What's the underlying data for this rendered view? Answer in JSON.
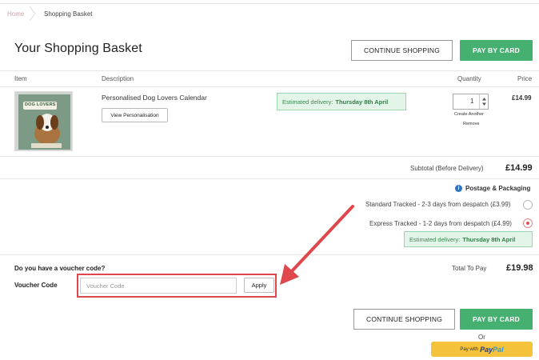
{
  "breadcrumb": {
    "home": "Home",
    "current": "Shopping Basket"
  },
  "page_title": "Your Shopping Basket",
  "buttons": {
    "continue_shopping": "CONTINUE SHOPPING",
    "pay_by_card": "PAY BY CARD",
    "apply": "Apply",
    "paypal_prefix": "Pay with",
    "paypal_word_1": "Pay",
    "paypal_word_2": "Pal"
  },
  "table_headers": {
    "item": "Item",
    "description": "Description",
    "quantity": "Quantity",
    "price": "Price"
  },
  "product": {
    "name": "Personalised Dog Lovers Calendar",
    "view_personalisation": "View Personalisation",
    "delivery_prefix": "Estimated delivery:",
    "delivery_date": "Thursday 8th April",
    "quantity": "1",
    "create_another": "Create Another",
    "remove": "Remove",
    "price": "£14.99",
    "thumb_banner": "DOG LOVERS"
  },
  "subtotal": {
    "label": "Subtotal (Before Delivery)",
    "value": "£14.99"
  },
  "postage": {
    "title": "Postage & Packaging",
    "options": [
      {
        "label": "Standard Tracked - 2-3 days from despatch (£3.99)",
        "selected": false
      },
      {
        "label": "Express Tracked - 1-2 days from despatch (£4.99)",
        "selected": true
      }
    ],
    "delivery_prefix": "Estimated delivery:",
    "delivery_date": "Thursday 8th April"
  },
  "voucher": {
    "question": "Do you have a voucher code?",
    "label": "Voucher Code",
    "placeholder": "Voucher Code"
  },
  "total": {
    "label": "Total To Pay",
    "value": "£19.98"
  },
  "or_text": "Or",
  "colors": {
    "accent_green": "#45b070",
    "annotation_red": "#e0474c",
    "paypal_yellow": "#f5c33b"
  }
}
